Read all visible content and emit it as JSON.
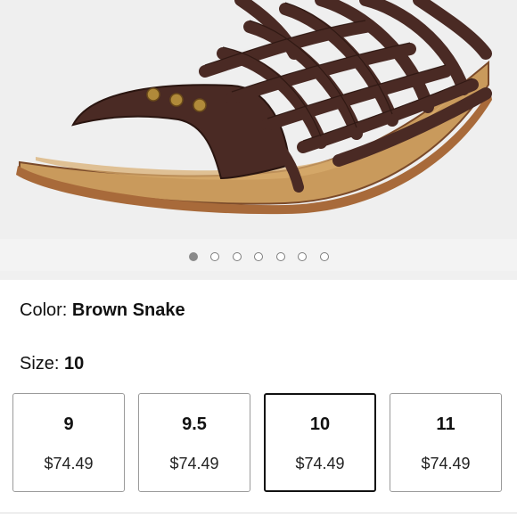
{
  "carousel": {
    "image_name": "brown-woven-leather-sandal",
    "dot_count": 7,
    "active_index": 0
  },
  "options": {
    "color_label": "Color:",
    "color_value": "Brown Snake",
    "size_label": "Size:",
    "size_value": "10"
  },
  "sizes": [
    {
      "size": "9",
      "price": "$74.49",
      "selected": false
    },
    {
      "size": "9.5",
      "price": "$74.49",
      "selected": false
    },
    {
      "size": "10",
      "price": "$74.49",
      "selected": true
    },
    {
      "size": "11",
      "price": "$74.49",
      "selected": false
    }
  ],
  "colors": {
    "leather": "#4a2a24",
    "sole": "#c99a5c",
    "rivet": "#b08a3a",
    "selected_border": "#111111"
  }
}
